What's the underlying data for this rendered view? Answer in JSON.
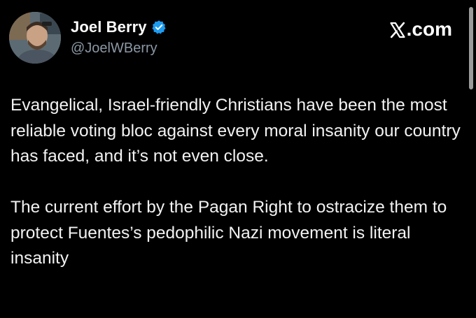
{
  "post": {
    "author": {
      "display_name": "Joel Berry",
      "handle": "@JoelWBerry",
      "verified": true,
      "avatar_icon": "user-avatar"
    },
    "brand": {
      "label": ".com",
      "icon": "x-logo-icon"
    },
    "paragraphs": [
      "Evangelical, Israel-friendly Christians have been the most reliable voting bloc against every moral insanity our country has faced, and it’s not even close.",
      "The current effort by the Pagan Right to ostracize them to protect Fuentes’s pedophilic Nazi movement is literal insanity"
    ]
  },
  "colors": {
    "background": "#000000",
    "text": "#e7e9ea",
    "handle": "#8b98a5",
    "verified_badge": "#1d9bf0",
    "scrollbar": "#9b9b9b"
  }
}
